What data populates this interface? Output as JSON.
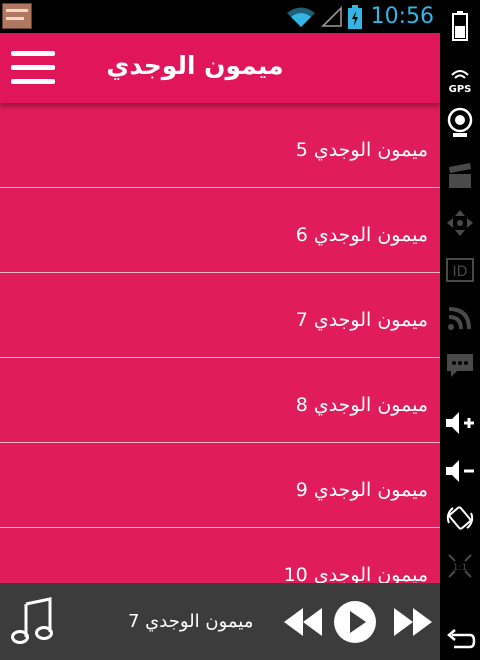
{
  "status_bar": {
    "time": "10:56"
  },
  "app_bar": {
    "title": "ميمون الوجدي"
  },
  "tracks": [
    {
      "label": "ميمون الوجدي 5"
    },
    {
      "label": "ميمون الوجدي 6"
    },
    {
      "label": "ميمون الوجدي 7"
    },
    {
      "label": "ميمون الوجدي 8"
    },
    {
      "label": "ميمون الوجدي 9"
    },
    {
      "label": "ميمون الوجدي 10"
    }
  ],
  "player": {
    "now_playing": "ميمون الوجدي 7"
  },
  "system_bar": {
    "gps_label": "GPS",
    "id_label": "ID",
    "ratio_label": "1:1"
  },
  "colors": {
    "accent": "#e01c5a",
    "status_blue": "#33b5e5",
    "player_bg": "#3c3c3c"
  }
}
